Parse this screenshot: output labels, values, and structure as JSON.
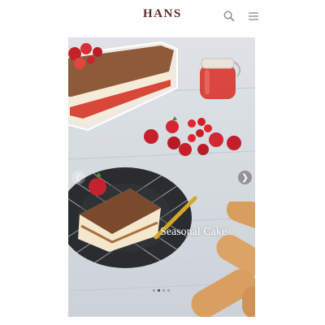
{
  "header": {
    "logo": "HANS",
    "search_icon": "search-icon",
    "menu_icon": "hamburger-menu-icon"
  },
  "carousel": {
    "caption": "Seasonal Cake",
    "slide_count": 4,
    "active_index": 1,
    "prev_icon": "chevron-left-icon",
    "next_icon": "chevron-right-icon"
  },
  "colors": {
    "logo": "#5a2d22",
    "background": "#ffffff"
  }
}
